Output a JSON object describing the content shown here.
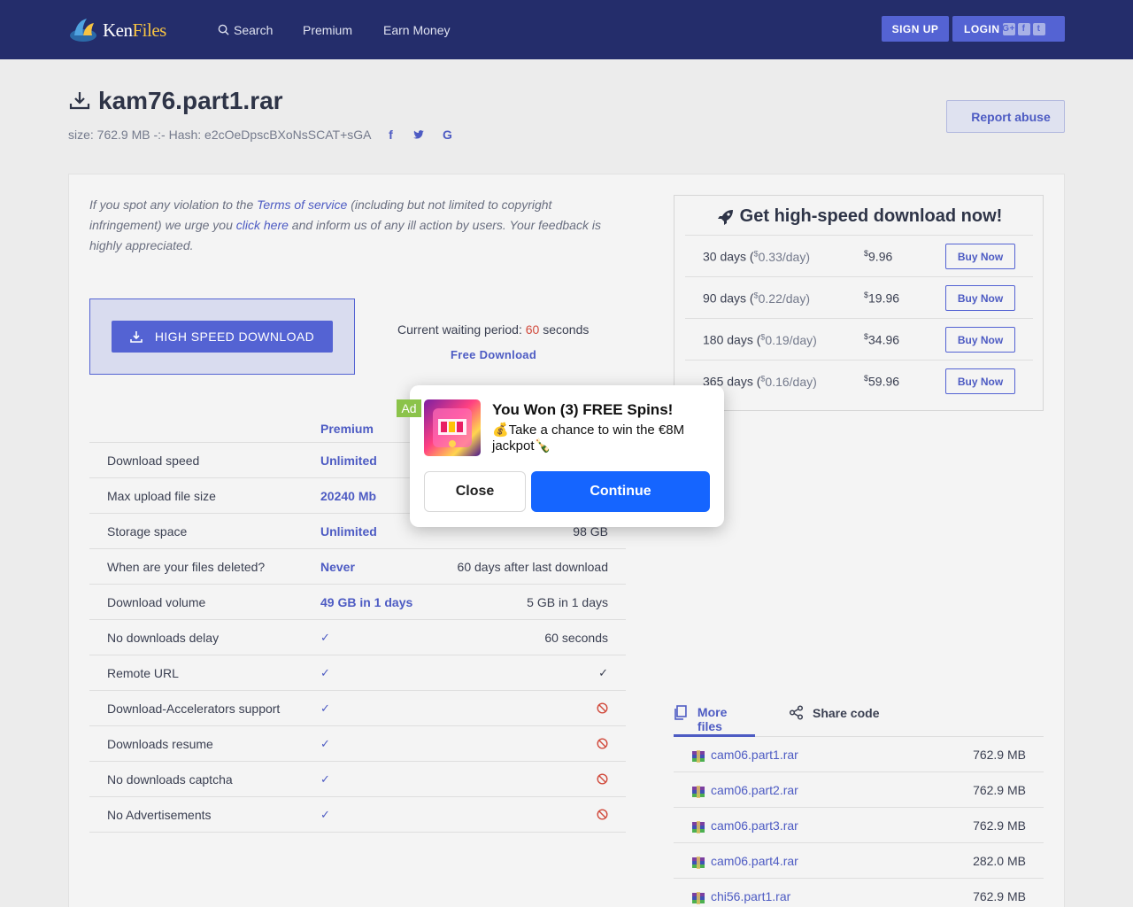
{
  "header": {
    "logo_text_a": "Ken",
    "logo_text_b": "Files",
    "nav_search": "Search",
    "nav_premium": "Premium",
    "nav_earn": "Earn Money",
    "signup": "SIGN UP",
    "login": "LOGIN",
    "login_social": [
      "G+",
      "f",
      "t"
    ]
  },
  "file": {
    "name": "kam76.part1.rar",
    "meta": "size: 762.9 MB -:- Hash: e2cOeDpscBXoNsSCAT+sGA",
    "report": "Report abuse"
  },
  "notice": {
    "p1": "If you spot any violation to the ",
    "link1": "Terms of service",
    "p2": " (including but not limited to copyright infringement) we urge you ",
    "link2": "click here",
    "p3": " and inform us of any ill action by users. Your feedback is highly appreciated."
  },
  "download": {
    "high_speed": "HIGH SPEED DOWNLOAD",
    "wait_prefix": "Current waiting period: ",
    "wait_seconds": "60",
    "wait_suffix": " seconds",
    "free": "Free Download"
  },
  "compare": {
    "premium_header": "Premium",
    "rows": [
      {
        "feature": "Download speed",
        "premium": "Unlimited",
        "free": ""
      },
      {
        "feature": "Max upload file size",
        "premium": "20240 Mb",
        "free": ""
      },
      {
        "feature": "Storage space",
        "premium": "Unlimited",
        "free": "98 GB"
      },
      {
        "feature": "When are your files deleted?",
        "premium": "Never",
        "free": "60 days after last download"
      },
      {
        "feature": "Download volume",
        "premium": "49 GB in 1 days",
        "free": "5 GB in 1 days"
      },
      {
        "feature": "No downloads delay",
        "premium": "✓",
        "free": "60 seconds"
      },
      {
        "feature": "Remote URL",
        "premium": "✓",
        "free": "✓"
      },
      {
        "feature": "Download-Accelerators support",
        "premium": "✓",
        "free": "no"
      },
      {
        "feature": "Downloads resume",
        "premium": "✓",
        "free": "no"
      },
      {
        "feature": "No downloads captcha",
        "premium": "✓",
        "free": "no"
      },
      {
        "feature": "No Advertisements",
        "premium": "✓",
        "free": "no"
      }
    ]
  },
  "premium_box": {
    "title": "Get high-speed download now!",
    "plans": [
      {
        "days": "30 days (",
        "per": "0.33/day",
        "price": "9.96",
        "buy": "Buy Now"
      },
      {
        "days": "90 days (",
        "per": "0.22/day",
        "price": "19.96",
        "buy": "Buy Now"
      },
      {
        "days": "180 days (",
        "per": "0.19/day",
        "price": "34.96",
        "buy": "Buy Now"
      },
      {
        "days": "365 days (",
        "per": "0.16/day",
        "price": "59.96",
        "buy": "Buy Now"
      }
    ],
    "currency": "$"
  },
  "tabs": {
    "more": "More files",
    "share": "Share code"
  },
  "more_files": [
    {
      "name": "cam06.part1.rar",
      "size": "762.9 MB"
    },
    {
      "name": "cam06.part2.rar",
      "size": "762.9 MB"
    },
    {
      "name": "cam06.part3.rar",
      "size": "762.9 MB"
    },
    {
      "name": "cam06.part4.rar",
      "size": "282.0 MB"
    },
    {
      "name": "chi56.part1.rar",
      "size": "762.9 MB"
    }
  ],
  "ad": {
    "badge": "Ad",
    "title": "You Won (3) FREE Spins!",
    "subtitle": "💰Take a chance to win the €8M jackpot🍾",
    "close": "Close",
    "continue": "Continue"
  }
}
